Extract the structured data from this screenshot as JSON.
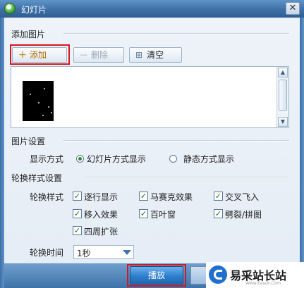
{
  "window": {
    "title": "幻灯片",
    "close": "✕"
  },
  "add_section": {
    "heading": "添加图片",
    "buttons": {
      "add": {
        "icon": "+",
        "label": "添加"
      },
      "delete": {
        "icon": "—",
        "label": "删除"
      },
      "clear": {
        "icon": "⊞",
        "label": "清空"
      }
    }
  },
  "settings": {
    "heading": "图片设置",
    "display_mode": {
      "label": "显示方式",
      "options": [
        "幻灯片方式显示",
        "静态方式显示"
      ],
      "selected": "幻灯片方式显示"
    }
  },
  "transitions": {
    "heading": "轮换样式设置",
    "style_label": "轮换样式",
    "styles": [
      {
        "label": "逐行显示",
        "checked": true
      },
      {
        "label": "马赛克效果",
        "checked": true
      },
      {
        "label": "交叉飞入",
        "checked": true
      },
      {
        "label": "移入效果",
        "checked": true
      },
      {
        "label": "百叶窗",
        "checked": true
      },
      {
        "label": "劈裂/拼图",
        "checked": true
      },
      {
        "label": "四周扩张",
        "checked": true
      }
    ],
    "interval_label": "轮换时间",
    "interval_value": "1秒"
  },
  "footer": {
    "play_label": "播放"
  },
  "watermark": {
    "text": "易采站长站",
    "sub": "Www.Easck.Com"
  },
  "colors": {
    "highlight": "#d6161e",
    "title_bar": "#3d6fa6",
    "accent": "#2e7fcc"
  }
}
